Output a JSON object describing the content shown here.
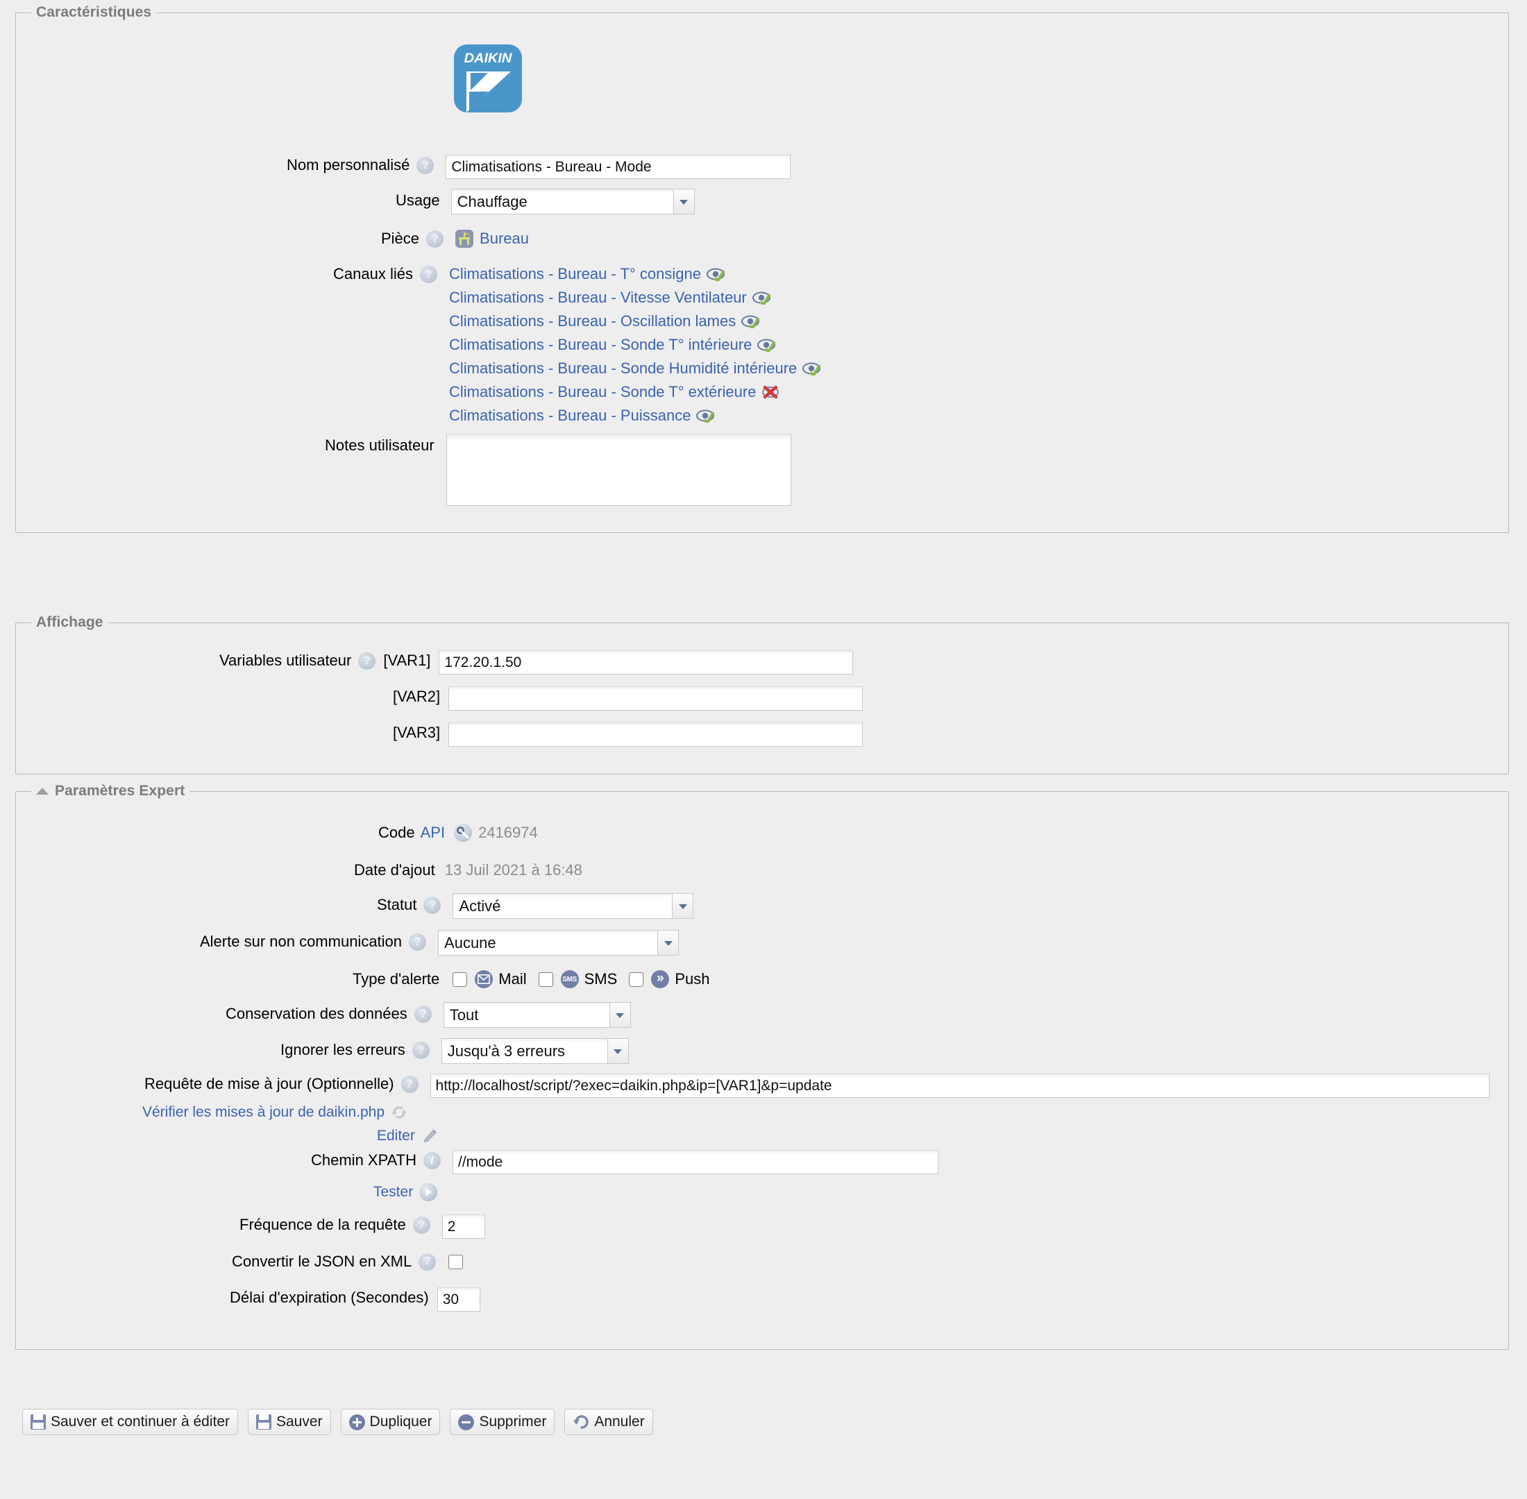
{
  "sections": {
    "caracteristiques": {
      "legend": "Caractéristiques"
    },
    "affichage": {
      "legend": "Affichage"
    },
    "expert": {
      "legend": "Paramètres Expert"
    }
  },
  "device": {
    "logo_name": "DAIKIN",
    "logo_color": "#4a95c9"
  },
  "caracteristiques": {
    "nom_personnalise": {
      "label": "Nom personnalisé",
      "value": "Climatisations - Bureau - Mode"
    },
    "usage": {
      "label": "Usage",
      "value": "Chauffage"
    },
    "piece": {
      "label": "Pièce",
      "value": "Bureau",
      "icon": "desk-icon"
    },
    "canaux_lies": {
      "label": "Canaux liés",
      "items": [
        {
          "name": "Climatisations - Bureau - T° consigne",
          "status": "ok",
          "status_icon": "eye-check-icon"
        },
        {
          "name": "Climatisations - Bureau - Vitesse Ventilateur",
          "status": "ok",
          "status_icon": "eye-check-icon"
        },
        {
          "name": "Climatisations - Bureau - Oscillation lames",
          "status": "ok",
          "status_icon": "eye-check-icon"
        },
        {
          "name": "Climatisations - Bureau - Sonde T° intérieure",
          "status": "ok",
          "status_icon": "eye-check-icon"
        },
        {
          "name": "Climatisations - Bureau - Sonde Humidité intérieure",
          "status": "ok",
          "status_icon": "eye-check-icon"
        },
        {
          "name": "Climatisations - Bureau - Sonde T° extérieure",
          "status": "error",
          "status_icon": "eye-cross-icon"
        },
        {
          "name": "Climatisations - Bureau - Puissance",
          "status": "ok",
          "status_icon": "eye-check-icon"
        }
      ]
    },
    "notes_utilisateur": {
      "label": "Notes utilisateur",
      "value": ""
    }
  },
  "affichage": {
    "variables_label": "Variables utilisateur",
    "vars": [
      {
        "label": "[VAR1]",
        "value": "172.20.1.50"
      },
      {
        "label": "[VAR2]",
        "value": ""
      },
      {
        "label": "[VAR3]",
        "value": ""
      }
    ]
  },
  "expert": {
    "code_api": {
      "label_1": "Code",
      "label_2": "API",
      "value": "2416974",
      "icon": "key-icon"
    },
    "date_ajout": {
      "label": "Date d'ajout",
      "value": "13 Juil 2021 à 16:48"
    },
    "statut": {
      "label": "Statut",
      "value": "Activé"
    },
    "alerte_non_comm": {
      "label": "Alerte sur non communication",
      "value": "Aucune"
    },
    "type_alerte": {
      "label": "Type d'alerte",
      "options": [
        {
          "label": "Mail",
          "checked": false,
          "icon": "mail-icon",
          "glyph": "✉"
        },
        {
          "label": "SMS",
          "checked": false,
          "icon": "sms-icon",
          "glyph": "SMS"
        },
        {
          "label": "Push",
          "checked": false,
          "icon": "push-icon",
          "glyph": "»"
        }
      ]
    },
    "conservation": {
      "label": "Conservation des données",
      "value": "Tout"
    },
    "ignorer_erreurs": {
      "label": "Ignorer les erreurs",
      "value": "Jusqu'à 3 erreurs"
    },
    "requete": {
      "label": "Requête de mise à jour (Optionnelle)",
      "value": "http://localhost/script/?exec=daikin.php&ip=[VAR1]&p=update"
    },
    "verifier_link": {
      "label": "Vérifier les mises à jour de daikin.php",
      "icon": "refresh-icon"
    },
    "editer_link": {
      "label": "Editer",
      "icon": "pencil-icon"
    },
    "xpath": {
      "label": "Chemin XPATH",
      "value": "//mode"
    },
    "tester_link": {
      "label": "Tester",
      "icon": "play-icon"
    },
    "frequence": {
      "label": "Fréquence de la requête",
      "value": "2"
    },
    "json_xml": {
      "label": "Convertir le JSON en XML",
      "checked": false
    },
    "delai": {
      "label": "Délai d'expiration (Secondes)",
      "value": "30"
    }
  },
  "buttons": [
    {
      "label": "Sauver et continuer à éditer",
      "icon": "save-icon"
    },
    {
      "label": "Sauver",
      "icon": "save-icon"
    },
    {
      "label": "Dupliquer",
      "icon": "duplicate-icon"
    },
    {
      "label": "Supprimer",
      "icon": "delete-icon"
    },
    {
      "label": "Annuler",
      "icon": "undo-icon"
    }
  ]
}
